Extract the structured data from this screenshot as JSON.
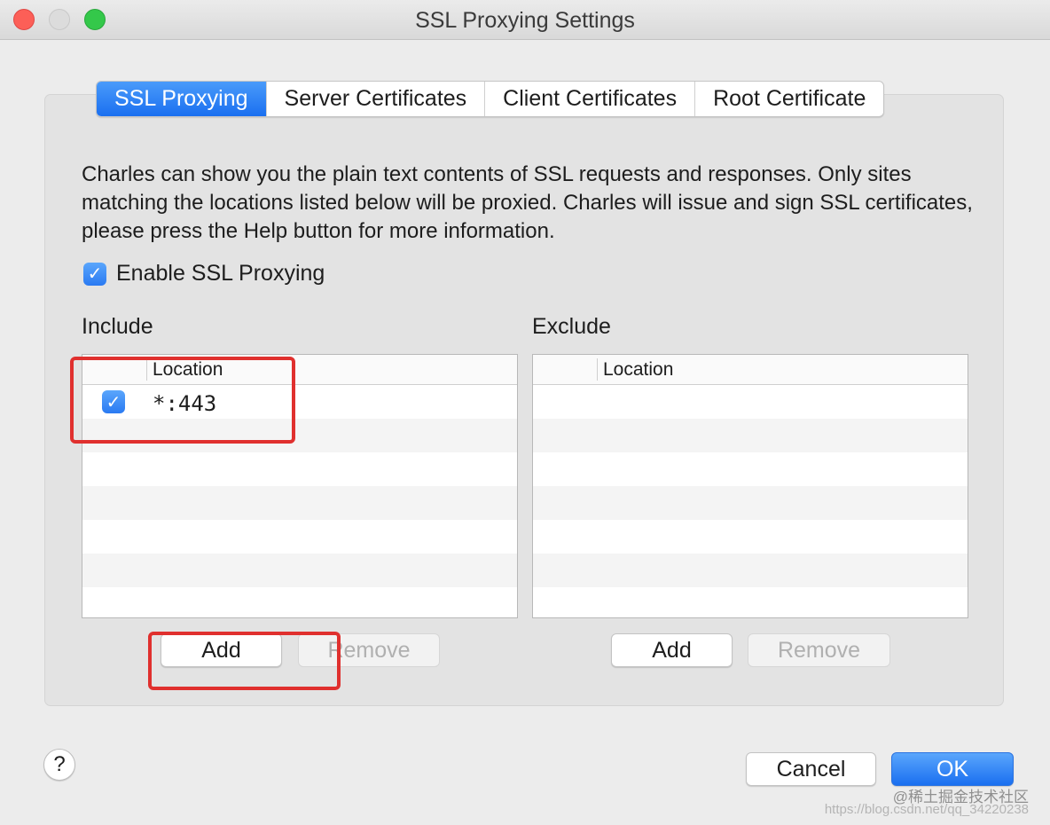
{
  "window": {
    "title": "SSL Proxying Settings"
  },
  "tabs": [
    {
      "label": "SSL Proxying",
      "active": true
    },
    {
      "label": "Server Certificates",
      "active": false
    },
    {
      "label": "Client Certificates",
      "active": false
    },
    {
      "label": "Root Certificate",
      "active": false
    }
  ],
  "description": "Charles can show you the plain text contents of SSL requests and responses. Only sites matching the locations listed below will be proxied. Charles will issue and sign SSL certificates, please press the Help button for more information.",
  "enable": {
    "label": "Enable SSL Proxying",
    "checked": true,
    "checkmark": "✓"
  },
  "include": {
    "label": "Include",
    "column_header": "Location",
    "rows": [
      {
        "enabled": true,
        "location": "*:443"
      }
    ],
    "add_label": "Add",
    "remove_label": "Remove"
  },
  "exclude": {
    "label": "Exclude",
    "column_header": "Location",
    "rows": [],
    "add_label": "Add",
    "remove_label": "Remove"
  },
  "footer": {
    "help_label": "?",
    "cancel_label": "Cancel",
    "ok_label": "OK"
  },
  "watermark": {
    "line1": "@稀土掘金技术社区",
    "line2": "https://blog.csdn.net/qq_34220238"
  },
  "colors": {
    "accent": "#1a6ff0",
    "highlight": "#e0302e"
  }
}
